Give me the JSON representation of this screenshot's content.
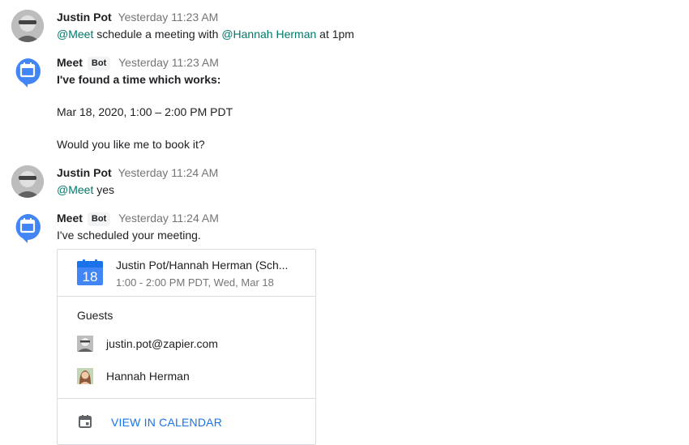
{
  "messages": [
    {
      "sender": "Justin Pot",
      "time": "Yesterday 11:23 AM",
      "mention1": "@Meet",
      "text1": " schedule a meeting with ",
      "mention2": "@Hannah Herman",
      "text2": " at 1pm"
    },
    {
      "sender": "Meet",
      "badge": "Bot",
      "time": "Yesterday 11:23 AM",
      "line1": "I've found a time which works:",
      "line2": "Mar 18, 2020, 1:00 – 2:00 PM PDT",
      "line3": "Would you like me to book it?"
    },
    {
      "sender": "Justin Pot",
      "time": "Yesterday 11:24 AM",
      "mention1": "@Meet",
      "text1": " yes"
    },
    {
      "sender": "Meet",
      "badge": "Bot",
      "time": "Yesterday 11:24 AM",
      "line1": "I've scheduled your meeting."
    }
  ],
  "event_card": {
    "calendar_day": "18",
    "title": "Justin Pot/Hannah Herman (Sch...",
    "time": "1:00 - 2:00 PM PDT, Wed, Mar 18",
    "guests_label": "Guests",
    "guests": [
      "justin.pot@zapier.com",
      "Hannah Herman"
    ],
    "view_link": "VIEW IN CALENDAR"
  },
  "colors": {
    "mention": "#00796b",
    "bot_blue": "#4285f4",
    "link": "#1a73e8"
  },
  "icons": {
    "bot_avatar": "calendar-bubble-icon",
    "event": "google-calendar-icon",
    "footer": "calendar-icon"
  }
}
